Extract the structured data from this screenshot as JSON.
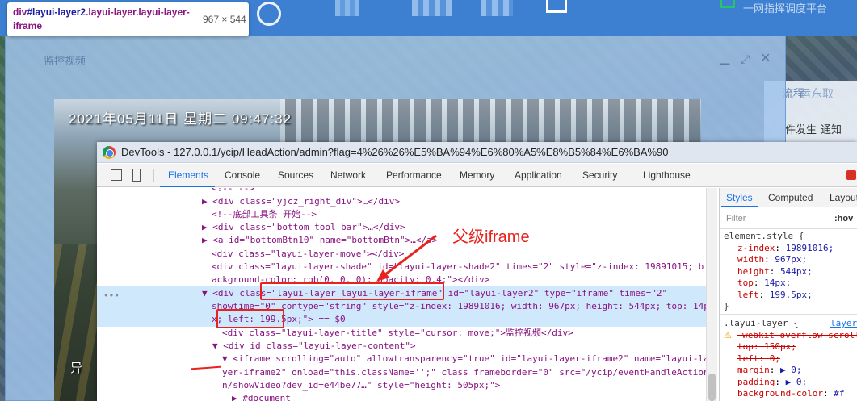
{
  "background": {
    "header_text": "一网指挥调度平台",
    "panel": {
      "tab_left": "流程",
      "tab_right": "运东取",
      "label_occurred": "件发生",
      "label_notify": "通知"
    }
  },
  "tooltip": {
    "selector_tag": "div",
    "selector_id": "#layui-layer2",
    "selector_classes": ".layui-layer.layui-layer-iframe",
    "dimensions": "967 × 544"
  },
  "layer": {
    "title": "监控视频",
    "controls": {
      "minimize": "▁",
      "maximize": "⤢",
      "close": "✕"
    },
    "video": {
      "timestamp": "2021年05月11日  星期二  09:47:32",
      "bottom_text": "异"
    }
  },
  "devtools": {
    "window_title": "DevTools - 127.0.0.1/ycip/HeadAction/admin?flag=4%26%26%E5%BA%94%E6%80%A5%E8%B5%84%E6%BA%90",
    "tabs": [
      "Elements",
      "Console",
      "Sources",
      "Network",
      "Performance",
      "Memory",
      "Application",
      "Security",
      "Lighthouse"
    ],
    "active_tab": "Elements",
    "dom_lines": [
      {
        "text": "<!--  -->"
      },
      {
        "text": "▶ <div class=\"yjcz_right_div\">…</div>"
      },
      {
        "text": "<!--底部工具条 开始-->"
      },
      {
        "text": "▶ <div class=\"bottom_tool_bar\">…</div>"
      },
      {
        "text": "▶ <a id=\"bottomBtn10\" name=\"bottomBtn\">…</a>"
      },
      {
        "text": "<div class=\"layui-layer-move\"></div>"
      },
      {
        "text": "<div class=\"layui-layer-shade\" id=\"layui-layer-shade2\" times=\"2\" style=\"z-index: 19891015; b"
      },
      {
        "text": "ackground-color: rgb(0, 0, 0); opacity: 0.4;\"></div>"
      },
      {
        "text": "▼ <div class=\"layui-layer layui-layer-iframe\" id=\"layui-layer2\" type=\"iframe\" times=\"2\""
      },
      {
        "text": "showtime=\"0\" contype=\"string\" style=\"z-index: 19891016; width: 967px; height: 544px; top: 14p"
      },
      {
        "text": "x; left: 199.5px;\"> == $0"
      },
      {
        "text": "<div class=\"layui-layer-title\" style=\"cursor: move;\">监控视频</div>"
      },
      {
        "text": "▼ <div id class=\"layui-layer-content\">"
      },
      {
        "text": "▼ <iframe scrolling=\"auto\" allowtransparency=\"true\" id=\"layui-layer-iframe2\" name=\"layui-la"
      },
      {
        "text": "yer-iframe2\" onload=\"this.className='';\" class frameborder=\"0\" src=\"/ycip/eventHandleAction"
      },
      {
        "text": "n/showVideo?dev_id=e44be77…\" style=\"height: 505px;\">"
      },
      {
        "text": "▶ #document"
      }
    ],
    "styles": {
      "tabs": [
        "Styles",
        "Computed",
        "Layout"
      ],
      "active_tab": "Styles",
      "filter_placeholder": "Filter",
      "hov": ":hov",
      "element_style_selector": "element.style {",
      "element_style": [
        {
          "prop": "z-index",
          "value": "19891016;"
        },
        {
          "prop": "width",
          "value": "967px;"
        },
        {
          "prop": "height",
          "value": "544px;"
        },
        {
          "prop": "top",
          "value": "14px;"
        },
        {
          "prop": "left",
          "value": "199.5px;"
        }
      ],
      "close_brace": "}",
      "rule2_selector": ".layui-layer {",
      "rule2_source": "layer",
      "rule2_props": [
        {
          "prop": "-webkit-overflow-scrolling",
          "value": "",
          "struck": true,
          "warn": true
        },
        {
          "prop": "top",
          "value": "150px;",
          "struck": true
        },
        {
          "prop": "left",
          "value": "0;",
          "struck": true
        },
        {
          "prop": "margin",
          "value": "▶ 0;"
        },
        {
          "prop": "padding",
          "value": "▶ 0;"
        },
        {
          "prop": "background-color",
          "value": "#f"
        }
      ]
    }
  },
  "annotation": {
    "label": "父级iframe",
    "color": "#e8221c"
  }
}
